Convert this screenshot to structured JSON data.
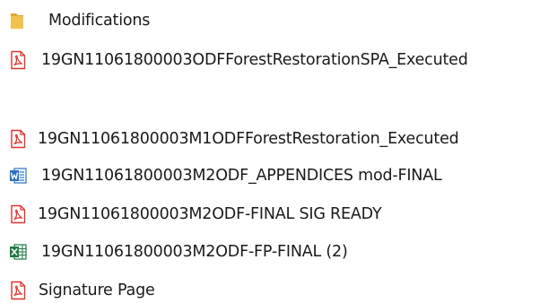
{
  "colors": {
    "folder": "#f2c14e",
    "folder_dark": "#e0a82e",
    "pdf": "#e0332c",
    "word": "#2b6fc6",
    "excel": "#1e7a45"
  },
  "items": [
    {
      "name": "Modifications",
      "icon": "folder-icon"
    },
    {
      "name": "19GN11061800003ODFForestRestorationSPA_Executed",
      "icon": "pdf-file-icon"
    },
    {
      "name": "19GN11061800003M1ODFForestRestoration_Executed",
      "icon": "pdf-file-icon"
    },
    {
      "name": "19GN11061800003M2ODF_APPENDICES mod-FINAL",
      "icon": "word-file-icon"
    },
    {
      "name": "19GN11061800003M2ODF-FINAL SIG READY",
      "icon": "pdf-file-icon"
    },
    {
      "name": "19GN11061800003M2ODF-FP-FINAL (2)",
      "icon": "excel-file-icon"
    },
    {
      "name": "Signature Page",
      "icon": "pdf-file-icon"
    }
  ]
}
